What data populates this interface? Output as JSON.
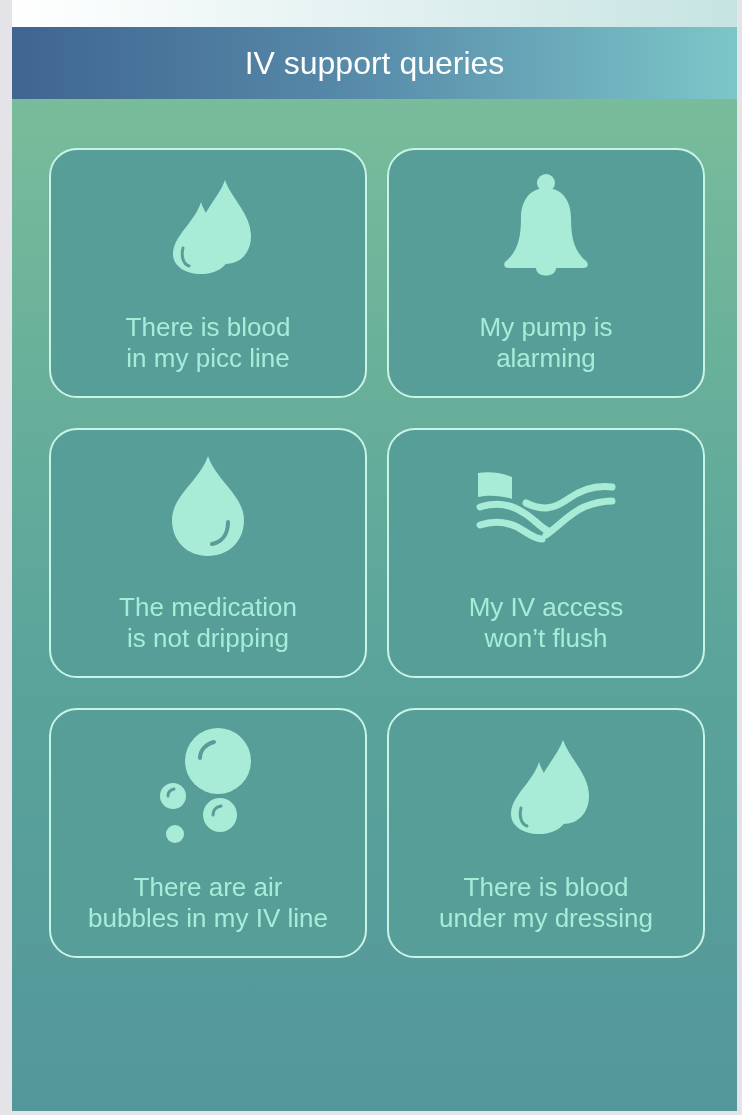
{
  "header": {
    "title": "IV support queries"
  },
  "tiles": [
    {
      "kind": "drops",
      "lines": [
        "There is blood",
        "in my picc line"
      ]
    },
    {
      "kind": "bell",
      "lines": [
        "My pump is",
        "alarming"
      ]
    },
    {
      "kind": "drop",
      "lines": [
        "The medication",
        "is not dripping"
      ]
    },
    {
      "kind": "tube",
      "lines": [
        "My IV access",
        "won’t flush"
      ]
    },
    {
      "kind": "bubbles",
      "lines": [
        "There are air",
        "bubbles in my IV line"
      ]
    },
    {
      "kind": "drops",
      "lines": [
        "There is blood",
        "under my dressing"
      ]
    }
  ]
}
